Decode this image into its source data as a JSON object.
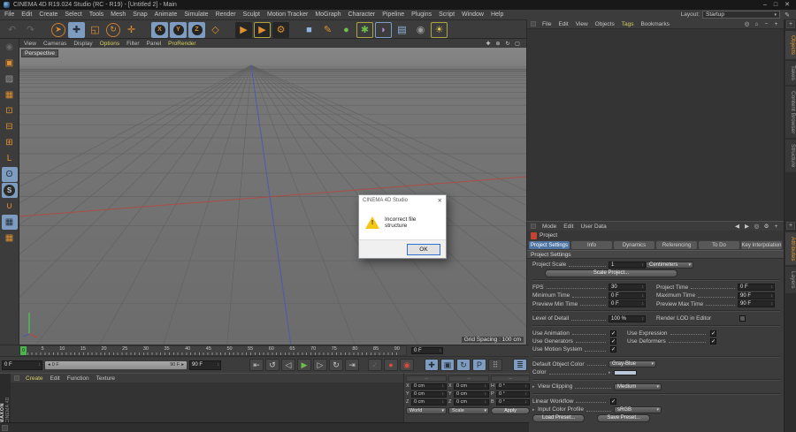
{
  "window": {
    "title": "CINEMA 4D R19.024 Studio (RC - R19) - [Untitled 2] - Main",
    "minimize": "–",
    "maximize": "□",
    "close": "✕"
  },
  "menu_bar": {
    "items": [
      "File",
      "Edit",
      "Create",
      "Select",
      "Tools",
      "Mesh",
      "Snap",
      "Animate",
      "Simulate",
      "Render",
      "Sculpt",
      "Motion Tracker",
      "MoGraph",
      "Character",
      "Pipeline",
      "Plugins",
      "Script",
      "Window",
      "Help"
    ],
    "highlight": [],
    "layout_label": "Layout:",
    "layout_value": "Startup"
  },
  "toolbar": {
    "groups": [
      [
        {
          "name": "undo-icon",
          "tone": "dim"
        },
        {
          "name": "redo-icon",
          "tone": "dim"
        }
      ],
      [
        {
          "name": "live-selection-tool",
          "tone": "orange",
          "ring": true
        },
        {
          "name": "move-tool",
          "active": true
        },
        {
          "name": "scale-tool",
          "tone": "orange"
        },
        {
          "name": "rotate-tool",
          "tone": "orange",
          "ring": true
        },
        {
          "name": "last-used-tool",
          "tone": "orange"
        }
      ],
      [
        {
          "name": "lock-x-axis",
          "axis": true
        },
        {
          "name": "lock-y-axis",
          "axis": true
        },
        {
          "name": "lock-z-axis",
          "axis": true
        },
        {
          "name": "coordinate-system-toggle",
          "tone": "orange"
        }
      ],
      [
        {
          "name": "render-view-button",
          "tone": "orange",
          "dark": true
        },
        {
          "name": "render-picture-viewer-button",
          "tone": "orange",
          "dark": true,
          "frame": "yellow"
        },
        {
          "name": "render-settings-button",
          "tone": "orange",
          "dark": true
        }
      ],
      [
        {
          "name": "add-cube-button",
          "tone": "blue"
        },
        {
          "name": "spline-pen-button",
          "tone": "orange"
        },
        {
          "name": "subdivision-surface-button",
          "tone": "green"
        },
        {
          "name": "generators-button",
          "tone": "green",
          "frame": "yellow"
        },
        {
          "name": "deformers-button",
          "tone": "purple",
          "frame": "blue"
        },
        {
          "name": "environment-button",
          "tone": "blue"
        },
        {
          "name": "camera-button",
          "tone": "dim2"
        },
        {
          "name": "light-button",
          "tone": "yellow",
          "frame": "yellow"
        }
      ]
    ]
  },
  "left_toolbar": {
    "icons": [
      {
        "name": "make-editable-button",
        "tone": "dim"
      },
      {
        "name": "model-mode-button",
        "tone": "orange"
      },
      {
        "name": "texture-mode-button",
        "tone": "dim2"
      },
      {
        "name": "workplane-mode-button",
        "tone": "orange"
      },
      {
        "name": "points-mode-button",
        "tone": "orange"
      },
      {
        "name": "edges-mode-button",
        "tone": "orange"
      },
      {
        "name": "polygons-mode-button",
        "tone": "orange"
      },
      {
        "name": "axis-mode-button",
        "tone": "orange"
      },
      {
        "name": "viewport-solo-button",
        "active": true
      },
      {
        "name": "snap-button",
        "active": true,
        "circ": true
      },
      {
        "name": "enable-snap-button",
        "tone": "orange"
      },
      {
        "name": "lock-workplane-button",
        "active": true
      },
      {
        "name": "planar-workplane-button",
        "tone": "orange"
      }
    ]
  },
  "viewport": {
    "menu": {
      "items": [
        "View",
        "Cameras",
        "Display",
        "Options",
        "Filter",
        "Panel",
        "ProRender"
      ],
      "highlight": [
        "Options",
        "ProRender"
      ]
    },
    "nav_icons": [
      {
        "name": "pan-view-icon"
      },
      {
        "name": "zoom-view-icon"
      },
      {
        "name": "rotate-view-icon"
      },
      {
        "name": "maximize-view-icon"
      }
    ],
    "camera_label": "Perspective",
    "grid_spacing": "Grid Spacing : 100 cm",
    "axis_colors": {
      "x": "#b14a41",
      "y": "#4fc04f",
      "z": "#4a57b5"
    },
    "grid_line_color": "#5c5c5c"
  },
  "dialog": {
    "title": "CINEMA 4D Studio",
    "close": "✕",
    "message": "Incorrect file structure",
    "ok_label": "OK",
    "warning_color": "#f6c712"
  },
  "object_manager": {
    "menu": {
      "items": [
        "File",
        "Edit",
        "View",
        "Objects",
        "Tags",
        "Bookmarks"
      ],
      "highlight": [
        "Tags"
      ]
    },
    "icons": [
      {
        "name": "search-icon"
      },
      {
        "name": "home-icon"
      },
      {
        "name": "minimize-panel-icon"
      },
      {
        "name": "expand-panel-icon"
      }
    ],
    "side_tabs": {
      "items": [
        "Objects",
        "Takes",
        "Content Browser",
        "Structure"
      ],
      "active": "Objects"
    }
  },
  "attribute_manager": {
    "menu": {
      "items": [
        "Mode",
        "Edit",
        "User Data"
      ],
      "highlight": []
    },
    "icons": [
      {
        "name": "back-arrow-icon",
        "tone": "dim"
      },
      {
        "name": "forward-arrow-icon",
        "tone": "dim"
      },
      {
        "name": "search-icon"
      },
      {
        "name": "settings-icon"
      },
      {
        "name": "expand-panel-icon"
      }
    ],
    "object_label": "Project",
    "tabs": {
      "items": [
        "Project Settings",
        "Info",
        "Dynamics",
        "Referencing",
        "To Do",
        "Key Interpolation"
      ],
      "active": "Project Settings"
    },
    "section": "Project Settings",
    "rows": [
      [
        {
          "t": "lbl",
          "v": "Project Scale"
        },
        {
          "t": "fld",
          "v": "1"
        },
        {
          "t": "dd",
          "v": "Centimeters"
        }
      ],
      [
        {
          "t": "btn",
          "v": "Scale Project..."
        }
      ],
      [
        {
          "t": "hr"
        }
      ],
      [
        {
          "t": "lbl",
          "v": "FPS"
        },
        {
          "t": "fld",
          "v": "30"
        },
        {
          "t": "lbl",
          "v": "Project Time"
        },
        {
          "t": "fld",
          "v": "0 F"
        }
      ],
      [
        {
          "t": "lbl",
          "v": "Minimum Time"
        },
        {
          "t": "fld",
          "v": "0 F"
        },
        {
          "t": "lbl",
          "v": "Maximum Time"
        },
        {
          "t": "fld",
          "v": "90 F"
        }
      ],
      [
        {
          "t": "lbl",
          "v": "Preview Min Time"
        },
        {
          "t": "fld",
          "v": "0 F"
        },
        {
          "t": "lbl",
          "v": "Preview Max Time"
        },
        {
          "t": "fld",
          "v": "90 F"
        }
      ],
      [
        {
          "t": "hr"
        }
      ],
      [
        {
          "t": "lbl",
          "v": "Level of Detail"
        },
        {
          "t": "fld",
          "v": "100 %"
        },
        {
          "t": "lbl",
          "v": "Render LOD in Editor",
          "nd": true
        },
        {
          "t": "chk",
          "v": false,
          "dim": true
        }
      ],
      [
        {
          "t": "hr"
        }
      ],
      [
        {
          "t": "lbl",
          "v": "Use Animation"
        },
        {
          "t": "chk",
          "v": true
        },
        {
          "t": "lbl",
          "v": "Use Expression"
        },
        {
          "t": "chk",
          "v": true
        }
      ],
      [
        {
          "t": "lbl",
          "v": "Use Generators"
        },
        {
          "t": "chk",
          "v": true
        },
        {
          "t": "lbl",
          "v": "Use Deformers"
        },
        {
          "t": "chk",
          "v": true
        }
      ],
      [
        {
          "t": "lbl",
          "v": "Use Motion System"
        },
        {
          "t": "chk",
          "v": true
        }
      ],
      [
        {
          "t": "hr"
        }
      ],
      [
        {
          "t": "lbl",
          "v": "Default Object Color"
        },
        {
          "t": "dd",
          "v": "Gray-Blue"
        }
      ],
      [
        {
          "t": "lbl",
          "v": "Color"
        },
        {
          "t": "exp"
        },
        {
          "t": "sw",
          "v": "#b9c7d8"
        }
      ],
      [
        {
          "t": "hr"
        }
      ],
      [
        {
          "t": "exp"
        },
        {
          "t": "lbl",
          "v": "View Clipping"
        },
        {
          "t": "dd",
          "v": "Medium"
        }
      ],
      [
        {
          "t": "hr"
        }
      ],
      [
        {
          "t": "lbl",
          "v": "Linear Workflow"
        },
        {
          "t": "chk",
          "v": true
        }
      ],
      [
        {
          "t": "exp"
        },
        {
          "t": "lbl",
          "v": "Input Color Profile"
        },
        {
          "t": "dd",
          "v": "sRGB"
        }
      ],
      [
        {
          "t": "btn",
          "v": "Load Preset..."
        },
        {
          "t": "btn",
          "v": "Save Preset..."
        }
      ]
    ],
    "side_tabs": {
      "items": [
        "Attributes",
        "Layers"
      ],
      "active": "Attributes"
    }
  },
  "timeline": {
    "ticks": [
      "0",
      "5",
      "10",
      "15",
      "20",
      "25",
      "30",
      "35",
      "40",
      "45",
      "50",
      "55",
      "60",
      "65",
      "70",
      "75",
      "80",
      "85",
      "90"
    ],
    "playhead": "0",
    "frame_field": "0 F"
  },
  "transport": {
    "start_field": "0 F",
    "slider_left": "0 F",
    "slider_right": "90 F",
    "end_field": "90 F",
    "buttons": [
      {
        "name": "go-to-start-button"
      },
      {
        "name": "play-backwards-button"
      },
      {
        "name": "previous-frame-button"
      },
      {
        "name": "play-forwards-button",
        "tone": "green"
      },
      {
        "name": "next-frame-button"
      },
      {
        "name": "loop-button"
      },
      {
        "name": "go-to-end-button"
      },
      {
        "sep": 6
      },
      {
        "name": "record-options-button",
        "tone": "dim"
      },
      {
        "name": "record-keyframe-button",
        "tone": "red"
      },
      {
        "name": "autokeying-button",
        "tone": "red"
      },
      {
        "sep": 8
      },
      {
        "name": "keyframe-position-button",
        "tone": "orange",
        "active": true
      },
      {
        "name": "keyframe-scale-button",
        "tone": "orange",
        "active": true
      },
      {
        "name": "keyframe-rotation-button",
        "tone": "orange",
        "active": true
      },
      {
        "name": "keyframe-parameter-button",
        "tone": "orange",
        "active": true
      },
      {
        "name": "keyframe-pla-button",
        "tone": "dim2"
      },
      {
        "sep": 8
      },
      {
        "name": "keyframe-selection-button",
        "tone": "orange",
        "active": true
      }
    ]
  },
  "material_manager": {
    "menu": {
      "items": [
        "Create",
        "Edit",
        "Function",
        "Texture"
      ],
      "highlight": [
        "Create"
      ]
    },
    "brand_line1": "MAXON",
    "brand_line2": "CINEMA 4D"
  },
  "coordinates": {
    "columns": [
      {
        "header": "–",
        "rows": [
          [
            "X",
            "0 cm"
          ],
          [
            "Y",
            "0 cm"
          ],
          [
            "Z",
            "0 cm"
          ]
        ],
        "footer": {
          "type": "dropdown",
          "value": "World"
        }
      },
      {
        "header": "–",
        "rows": [
          [
            "X",
            "0 cm"
          ],
          [
            "Y",
            "0 cm"
          ],
          [
            "Z",
            "0 cm"
          ]
        ],
        "footer": {
          "type": "dropdown",
          "value": "Scale"
        }
      },
      {
        "header": "–",
        "rows": [
          [
            "H",
            "0 °"
          ],
          [
            "P",
            "0 °"
          ],
          [
            "B",
            "0 °"
          ]
        ],
        "footer": {
          "type": "button",
          "value": "Apply"
        }
      }
    ]
  }
}
